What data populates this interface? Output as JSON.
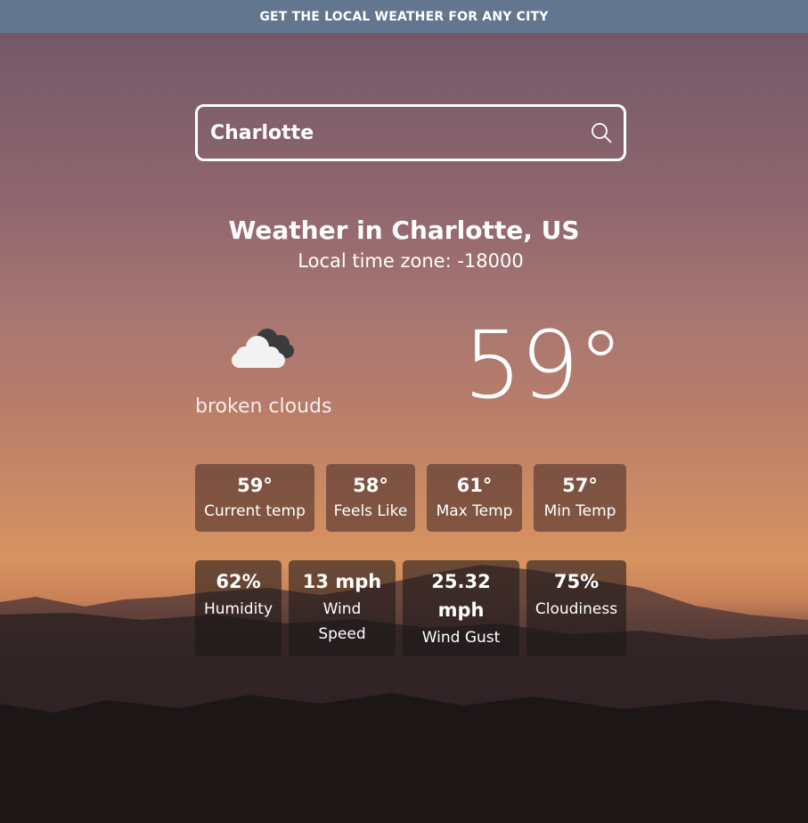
{
  "header": {
    "title": "GET THE LOCAL WEATHER FOR ANY CITY"
  },
  "search": {
    "value": "Charlotte",
    "icon": "search-icon"
  },
  "location": {
    "title": "Weather in Charlotte, US",
    "timezone": "Local time zone: -18000"
  },
  "current": {
    "icon": "broken-clouds-icon",
    "description": "broken clouds",
    "temperature": "59°"
  },
  "temps": [
    {
      "value": "59°",
      "label": "Current temp"
    },
    {
      "value": "58°",
      "label": "Feels Like"
    },
    {
      "value": "61°",
      "label": "Max Temp"
    },
    {
      "value": "57°",
      "label": "Min Temp"
    }
  ],
  "conditions": [
    {
      "value": "62%",
      "label": "Humidity"
    },
    {
      "value": "13 mph",
      "label": "Wind Speed"
    },
    {
      "value": "25.32 mph",
      "label": "Wind Gust"
    },
    {
      "value": "75%",
      "label": "Cloudiness"
    }
  ],
  "colors": {
    "header_bg": "#637690",
    "text": "#ffffff"
  }
}
